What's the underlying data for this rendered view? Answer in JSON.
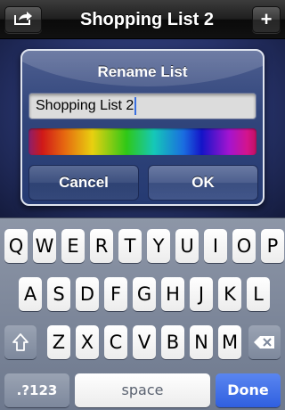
{
  "nav": {
    "title": "Shopping List 2",
    "left_icon": "share-icon",
    "right_label": "+"
  },
  "dialog": {
    "title": "Rename List",
    "input_value": "Shopping List 2",
    "color_picker": "rainbow-spectrum",
    "cancel_label": "Cancel",
    "ok_label": "OK"
  },
  "keyboard": {
    "row1": [
      "Q",
      "W",
      "E",
      "R",
      "T",
      "Y",
      "U",
      "I",
      "O",
      "P"
    ],
    "row2": [
      "A",
      "S",
      "D",
      "F",
      "G",
      "H",
      "J",
      "K",
      "L"
    ],
    "row3": [
      "Z",
      "X",
      "C",
      "V",
      "B",
      "N",
      "M"
    ],
    "shift_icon": "shift-icon",
    "delete_icon": "backspace-icon",
    "numbers_label": ".?123",
    "space_label": "space",
    "done_label": "Done"
  },
  "colors": {
    "done_key": "#2f5fe0",
    "dialog_bg": "#32467c"
  }
}
